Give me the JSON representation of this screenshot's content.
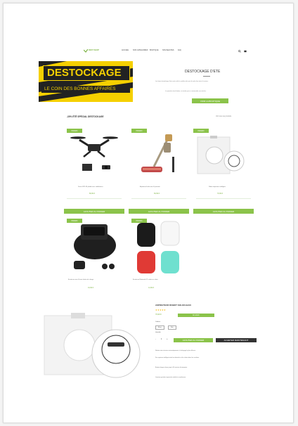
{
  "header": {
    "logo_text": "DEST SHOP",
    "nav": [
      "ACCUEIL",
      "NOS CATEGORIES",
      "BOUTIQUE",
      "NOUVEAUTES",
      "FAQ"
    ],
    "icons": [
      "search-icon",
      "cart-icon"
    ]
  },
  "hero": {
    "banner_title": "DESTOCKAGE",
    "banner_subtitle": "LE COIN DES BONNES AFFAIRES",
    "title": "DESTOCKAGE D'ETE",
    "text_1": "Les bons destockage d'ete sont enfin la, profitez des prix les plus bas toute la saison.",
    "text_2": "La quantite etant limitee, ne tardez pas a commander vos articles.",
    "cta": "VOIR LA BOUTIQUE"
  },
  "section": {
    "title": "-30% ÉTÉ SPÉCIAL DESTOCKAGE",
    "link": "Voir tous les produits"
  },
  "products_row1": [
    {
      "badge": "PROMO",
      "name": "Drone GPS 4K pliable avec stabilisateur",
      "price": "89,99 €",
      "btn": "AJOUTER AU PANIER"
    },
    {
      "badge": "PROMO",
      "name": "Aspirateur balai sans fil puissant",
      "price": "69,99 €",
      "btn": "AJOUTER AU PANIER"
    },
    {
      "badge": "PROMO",
      "name": "Robot aspirateur intelligent",
      "price": "79,99 €",
      "btn": "AJOUTER AU PANIER"
    }
  ],
  "products_row2": [
    {
      "badge": "PROMO",
      "name": "Ecouteurs sans fil avec boitier de charge",
      "price": "19,99 €"
    },
    {
      "badge": "PROMO",
      "name": "Ecouteurs Bluetooth i12 coloris au choix",
      "price": "14,99 €"
    }
  ],
  "featured": {
    "title": "ASPIRATEUR ROBOT SOLOCLEAN",
    "price": "79,99 €",
    "stock_label": "En stock",
    "option_label": "Couleur",
    "options": [
      "Blanc",
      "Noir"
    ],
    "qty_label": "Quantite",
    "qty_value": "1",
    "add_btn": "AJOUTER AU PANIER",
    "buy_btn": "ACHETER MAINTENANT",
    "desc": [
      "Nettoie votre interieur automatiquement, le balayage le plus efficace.",
      "Son systeme intelligent evite les obstacles et les chutes dans les escaliers.",
      "Batterie longue duree jusqu'a 90 minutes d'autonomie.",
      "Livraison gratuite et garantie satisfait ou rembourse."
    ]
  },
  "colors": {
    "accent": "#8bc34a",
    "banner_yellow": "#f5d000",
    "dark": "#222222"
  }
}
